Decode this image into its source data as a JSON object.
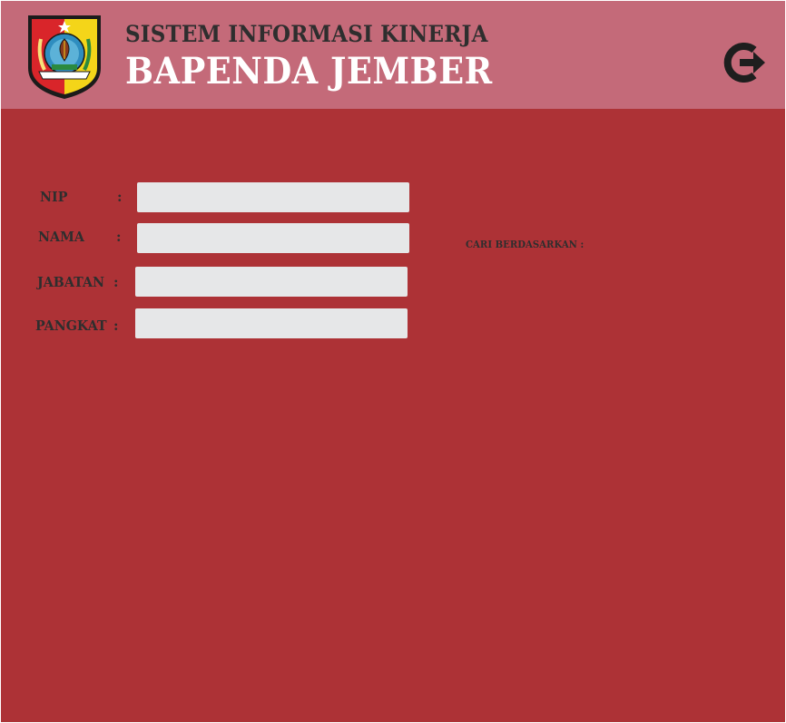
{
  "header": {
    "title_line1": "SISTEM INFORMASI KINERJA",
    "title_line2": "BAPENDA JEMBER",
    "logo_icon": "jember-regency-emblem-icon",
    "logout_icon": "logout-icon"
  },
  "form": {
    "colon": ":",
    "nip": {
      "label": "NIP",
      "value": ""
    },
    "nama": {
      "label": "NAMA",
      "value": ""
    },
    "jabatan": {
      "label": "JABATAN",
      "value": ""
    },
    "pangkat": {
      "label": "PANGKAT",
      "value": ""
    }
  },
  "search": {
    "label": "CARI BERDASARKAN :"
  },
  "colors": {
    "header_bg": "#c46a79",
    "body_bg": "#ad3236",
    "input_bg": "#e6e7e8",
    "title_dark": "#2e2e2e",
    "title_light": "#ffffff"
  }
}
